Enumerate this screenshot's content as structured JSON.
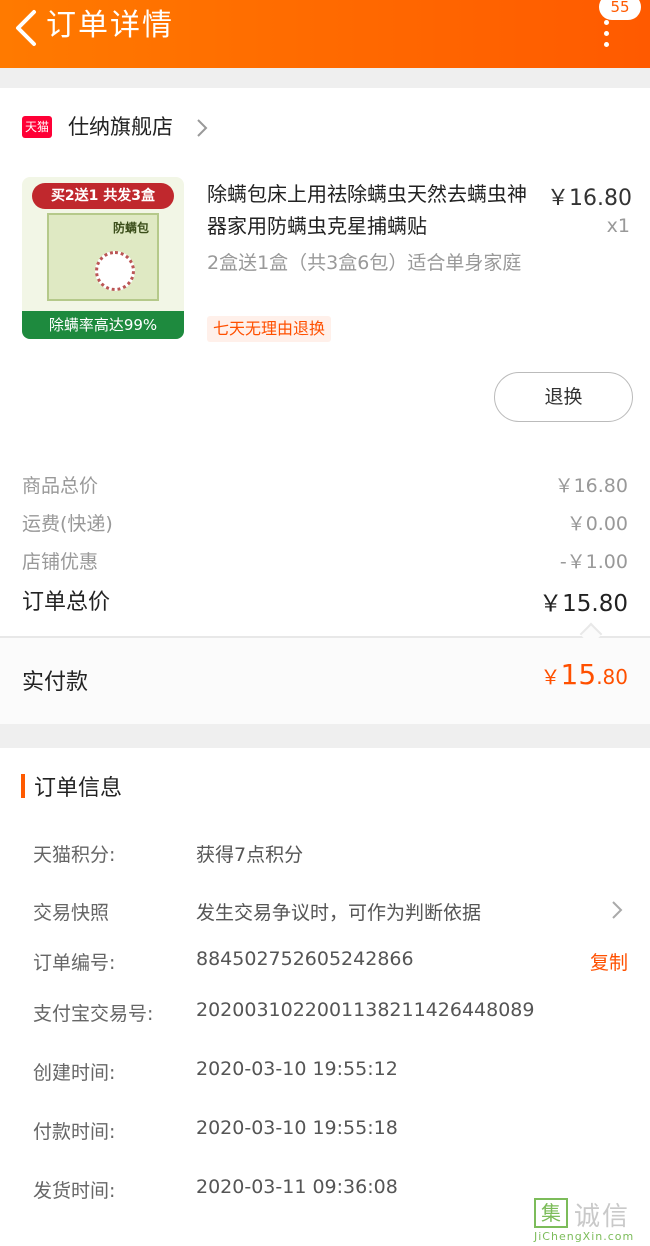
{
  "header": {
    "title": "订单详情",
    "badge": "55",
    "accent": "#ff5a00"
  },
  "shop": {
    "logo_text": "天猫",
    "name": "仕纳旗舰店"
  },
  "product": {
    "thumb_top": "买2送1 共发3盒",
    "thumb_tag": "防螨包",
    "thumb_bottom": "除螨率高达99%",
    "title": "除螨包床上用祛除螨虫天然去螨虫神器家用防螨虫克星捕螨贴",
    "spec": "2盒送1盒（共3盒6包）适合单身家庭",
    "service_tag": "七天无理由退换",
    "price": "￥16.80",
    "quantity": "x1",
    "refund_button": "退换"
  },
  "summary": {
    "rows": [
      {
        "label": "商品总价",
        "value": "￥16.80"
      },
      {
        "label": "运费(快递)",
        "value": "￥0.00"
      },
      {
        "label": "店铺优惠",
        "value": "-￥1.00"
      }
    ],
    "total_label": "订单总价",
    "total_value": "￥15.80",
    "paid_label": "实付款",
    "paid_yen": "￥",
    "paid_int": "15",
    "paid_dec": ".80"
  },
  "order_info": {
    "section_title": "订单信息",
    "rows": [
      {
        "label": "天猫积分:",
        "value": "获得7点积分"
      },
      {
        "label": "交易快照",
        "value": "发生交易争议时，可作为判断依据"
      },
      {
        "label": "订单编号:",
        "value": "884502752605242866"
      },
      {
        "label": "支付宝交易号:",
        "value": "2020031022001138211426448089"
      },
      {
        "label": "创建时间:",
        "value": "2020-03-10 19:55:12"
      },
      {
        "label": "付款时间:",
        "value": "2020-03-10 19:55:18"
      },
      {
        "label": "发货时间:",
        "value": "2020-03-11 09:36:08"
      }
    ],
    "copy_label": "复制"
  },
  "watermark": {
    "box": "集",
    "text": "诚信",
    "url": "JiChengXin.com"
  }
}
